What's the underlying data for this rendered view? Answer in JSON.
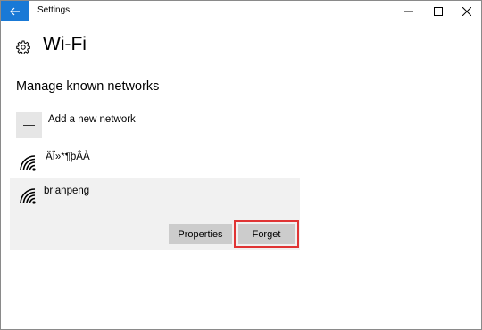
{
  "window": {
    "title": "Settings",
    "back_icon": "back-arrow-icon",
    "controls": [
      "minimize-icon",
      "maximize-icon",
      "close-icon"
    ],
    "accent_color": "#1979d6"
  },
  "header": {
    "icon": "gear-icon",
    "title": "Wi-Fi"
  },
  "section": {
    "title": "Manage known networks"
  },
  "add_network": {
    "icon": "plus-icon",
    "label": "Add a new network"
  },
  "networks": [
    {
      "name": "ÄÏ»*¶þÂÀ",
      "icon": "wifi-signal-icon",
      "selected": false
    },
    {
      "name": "brianpeng",
      "icon": "wifi-signal-icon",
      "selected": true
    }
  ],
  "actions": {
    "properties_label": "Properties",
    "forget_label": "Forget",
    "highlight_color": "#e03434"
  }
}
